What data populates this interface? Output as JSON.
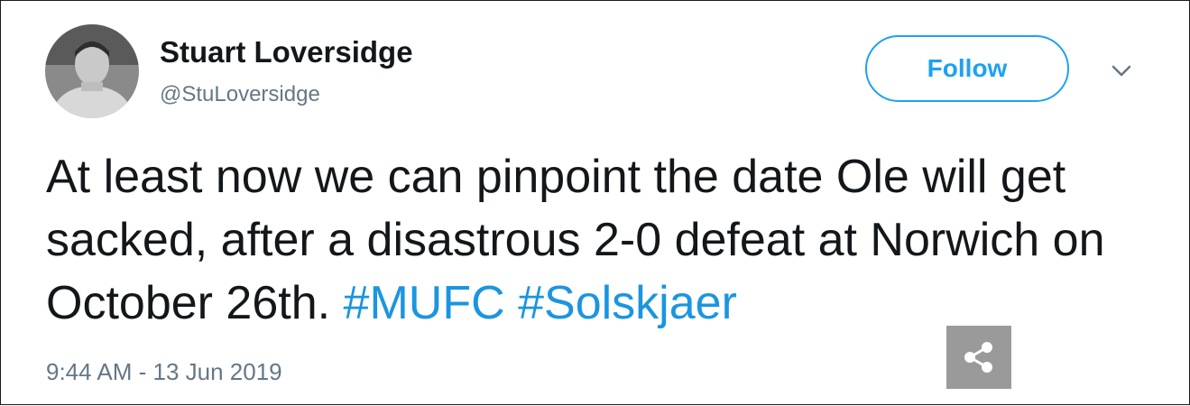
{
  "author": {
    "name": "Stuart Loversidge",
    "handle": "@StuLoversidge"
  },
  "follow_button": {
    "label": "Follow"
  },
  "menu": {
    "icon": "chevron-down-icon"
  },
  "tweet": {
    "text": "At least now we can pinpoint the date Ole will get sacked, after a disastrous 2-0 defeat at Norwich on October 26th.",
    "hashtags": [
      "#MUFC",
      "#Solskjaer"
    ]
  },
  "timestamp": "9:44 AM - 13 Jun 2019",
  "share": {
    "icon": "share-icon"
  },
  "colors": {
    "accent": "#1da1f2",
    "hashtag": "#1b95e0",
    "text": "#14171a",
    "muted": "#657786",
    "share_bg": "#9a9a9a"
  }
}
